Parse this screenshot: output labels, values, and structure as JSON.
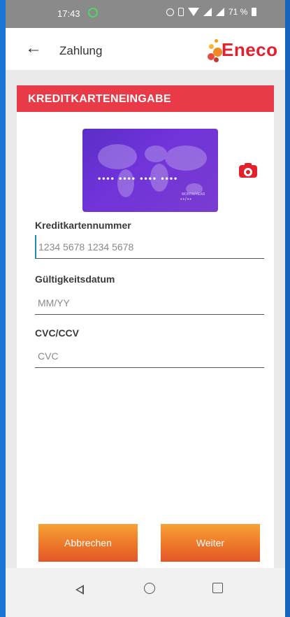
{
  "status_bar": {
    "time": "17:43",
    "battery": "71 %"
  },
  "app_bar": {
    "title": "Zahlung",
    "logo_text": "Eneco",
    "brand_color": "#e4202c"
  },
  "card": {
    "header_title": "KREDITKARTENEINGABE",
    "header_color": "#e83b47",
    "card_preview": {
      "number_mask": "•••• •••• •••• ••••",
      "expiry_label": "MONTH/YEAR",
      "expiry_mask": "••/••"
    },
    "fields": [
      {
        "label": "Kreditkartennummer",
        "placeholder": "1234 5678 1234 5678",
        "value": ""
      },
      {
        "label": "Gültigkeitsdatum",
        "placeholder": "MM/YY",
        "value": ""
      },
      {
        "label": "CVC/CCV",
        "placeholder": "CVC",
        "value": ""
      }
    ]
  },
  "buttons": {
    "cancel": "Abbrechen",
    "next": "Weiter",
    "gradient_top": "#f7a236",
    "gradient_bottom": "#e4552a"
  },
  "icons": {
    "back": "arrow-left-icon",
    "camera": "camera-icon",
    "nav_back": "triangle-back-icon",
    "nav_home": "circle-home-icon",
    "nav_recent": "square-recents-icon"
  }
}
